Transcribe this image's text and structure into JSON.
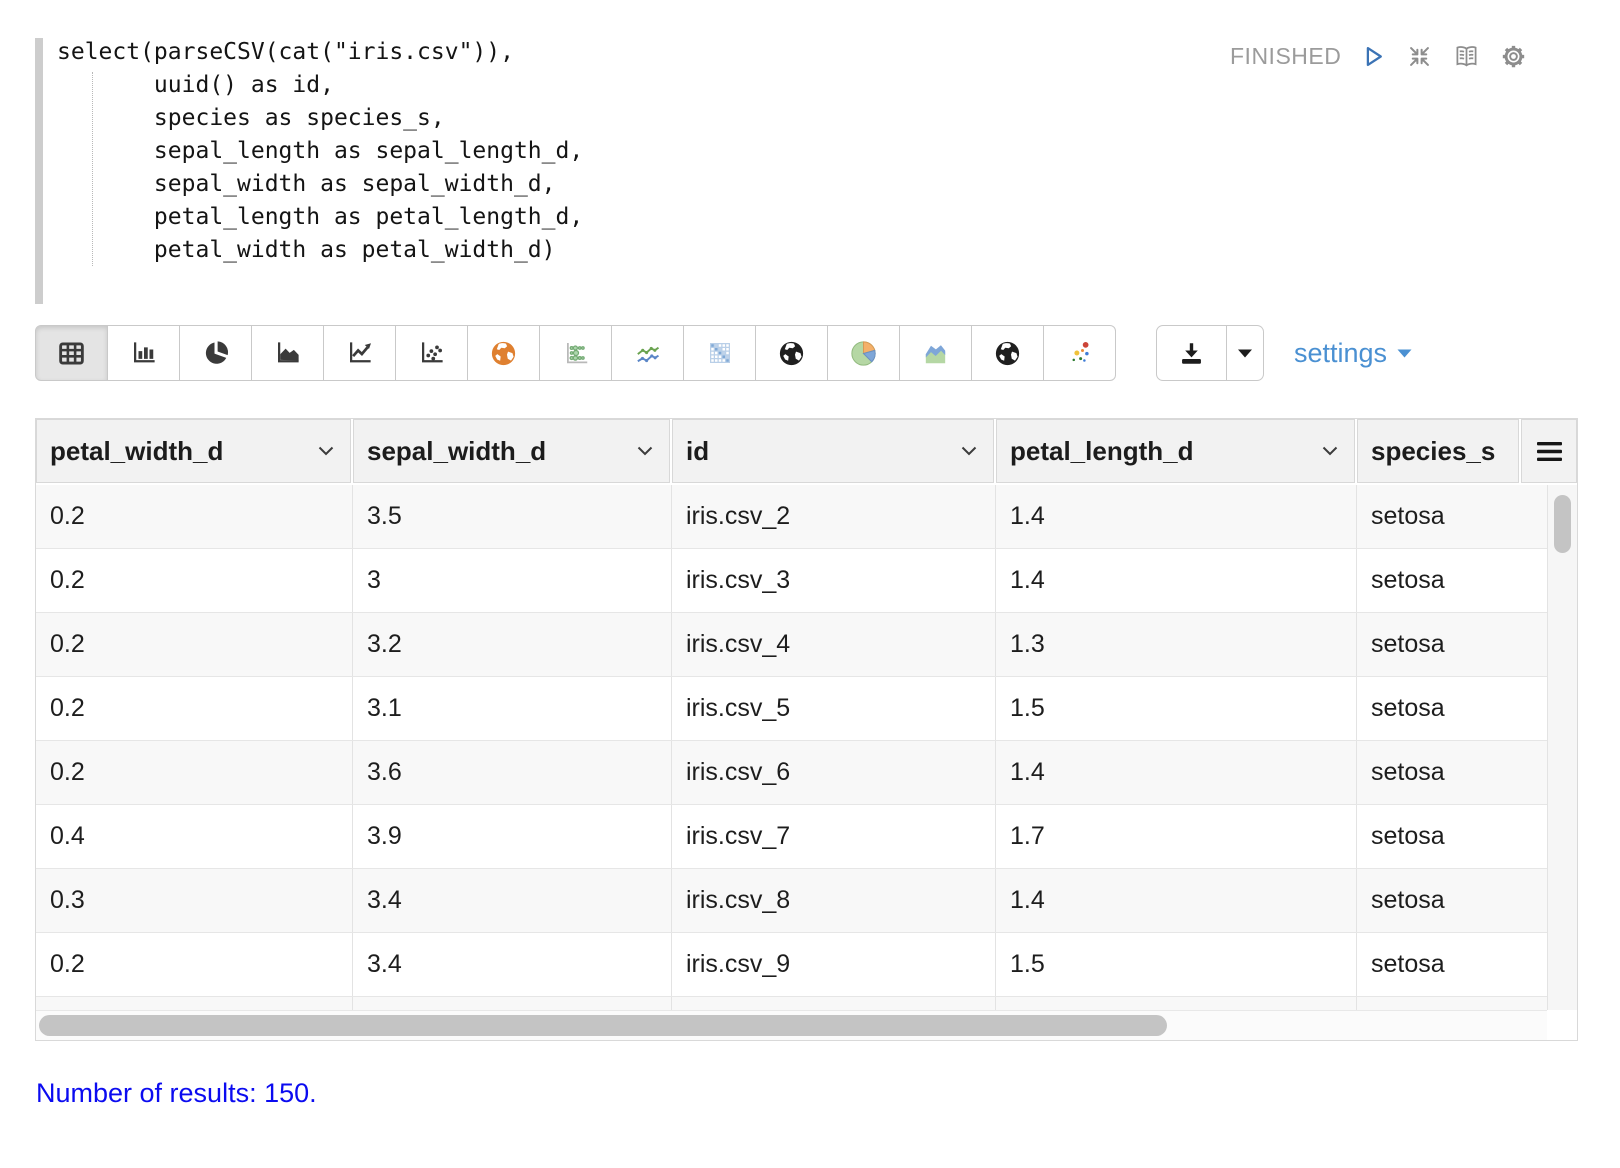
{
  "paragraph": {
    "status": "FINISHED",
    "code_lines": [
      "select(parseCSV(cat(\"iris.csv\")),",
      "       uuid() as id,",
      "       species as species_s,",
      "       sepal_length as sepal_length_d,",
      "       sepal_width as sepal_width_d,",
      "       petal_length as petal_length_d,",
      "       petal_width as petal_width_d)"
    ],
    "control_icons": [
      "run-icon",
      "collapse-icon",
      "report-book-icon",
      "gear-icon"
    ]
  },
  "toolbar": {
    "chart_types": [
      "table",
      "bar-chart",
      "pie-chart",
      "area-chart",
      "line-chart",
      "scatter-chart",
      "map-globe-orange",
      "bubble-chart",
      "multi-line-chart",
      "heatmap",
      "globe-dark",
      "pie-chart-colored",
      "area-chart-colored",
      "globe-dark-2",
      "scatter-colored"
    ],
    "selected_chart": "table",
    "download_icon": "download-icon",
    "settings_label": "settings"
  },
  "table": {
    "columns": [
      {
        "label": "petal_width_d",
        "sortable": true
      },
      {
        "label": "sepal_width_d",
        "sortable": true
      },
      {
        "label": "id",
        "sortable": true
      },
      {
        "label": "petal_length_d",
        "sortable": true
      },
      {
        "label": "species_s",
        "sortable": false
      }
    ],
    "menu_icon": "column-menu-icon",
    "rows": [
      [
        "0.2",
        "3.5",
        "iris.csv_2",
        "1.4",
        "setosa"
      ],
      [
        "0.2",
        "3",
        "iris.csv_3",
        "1.4",
        "setosa"
      ],
      [
        "0.2",
        "3.2",
        "iris.csv_4",
        "1.3",
        "setosa"
      ],
      [
        "0.2",
        "3.1",
        "iris.csv_5",
        "1.5",
        "setosa"
      ],
      [
        "0.2",
        "3.6",
        "iris.csv_6",
        "1.4",
        "setosa"
      ],
      [
        "0.4",
        "3.9",
        "iris.csv_7",
        "1.7",
        "setosa"
      ],
      [
        "0.3",
        "3.4",
        "iris.csv_8",
        "1.4",
        "setosa"
      ],
      [
        "0.2",
        "3.4",
        "iris.csv_9",
        "1.5",
        "setosa"
      ]
    ]
  },
  "footer": {
    "results_text": "Number of results: 150."
  },
  "colors": {
    "link_blue": "#4a90d2",
    "results_blue": "#0b0bf0",
    "status_gray": "#9b9b9b",
    "play_blue": "#3b73b5",
    "icon_dark": "#3a3a3a"
  }
}
